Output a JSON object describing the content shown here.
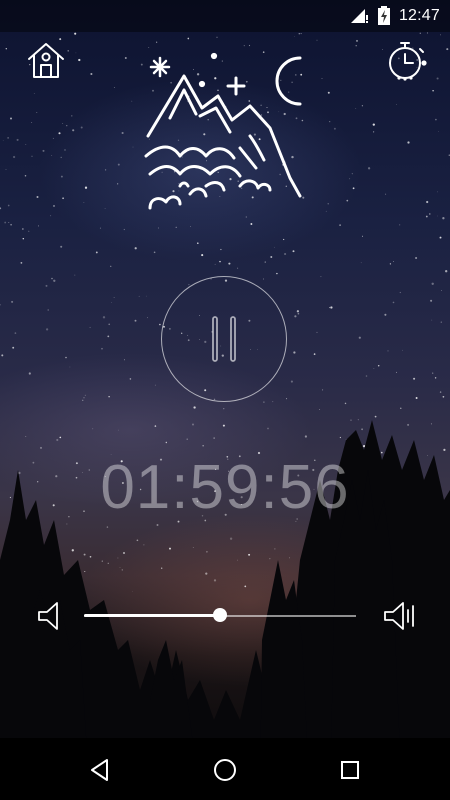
{
  "status_bar": {
    "time": "12:47",
    "icons": [
      "signal-icon",
      "battery-charging-icon"
    ]
  },
  "header": {
    "home_icon": "house-icon",
    "timer_icon": "stopwatch-icon",
    "scene_icon": "night-mountains-icon"
  },
  "player": {
    "state_icon": "pause-icon",
    "timer_display": "01:59:56"
  },
  "volume": {
    "level": 0.5,
    "low_icon": "volume-low-icon",
    "high_icon": "volume-high-icon"
  },
  "nav": {
    "items": [
      "back-icon",
      "home-circle-icon",
      "recents-icon"
    ]
  },
  "colors": {
    "icon": "#ffffff",
    "timer_text": "#ffffff66",
    "nav_background": "#000000",
    "sky_top": "#0d1330",
    "horizon_glow": "#823c32"
  }
}
